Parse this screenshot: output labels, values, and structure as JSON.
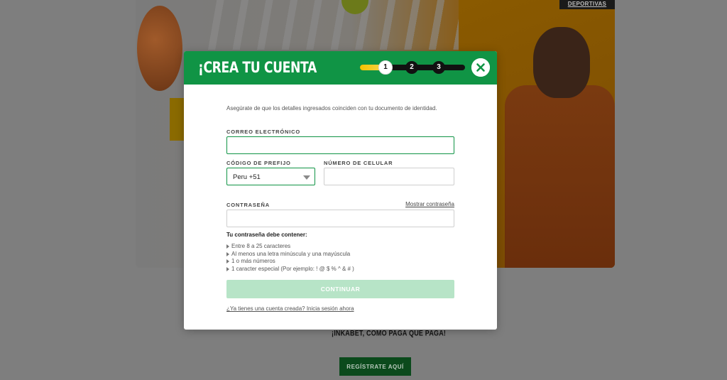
{
  "background": {
    "top_tab": "DEPORTIVAS",
    "slogan": "¡INKABET, CÓMO PAGA QUE PAGA!",
    "register_button": "REGÍSTRATE AQUÍ"
  },
  "modal": {
    "title": "¡CREA TU CUENTA",
    "steps": [
      "1",
      "2",
      "3"
    ],
    "current_step": 1,
    "progress": 0.22,
    "intro": "Asegúrate de que los detalles ingresados coinciden con tu documento de identidad.",
    "email": {
      "label": "CORREO ELECTRÓNICO",
      "value": ""
    },
    "prefix": {
      "label": "CÓDIGO DE PREFIJO",
      "value": "Peru +51"
    },
    "phone": {
      "label": "NÚMERO DE CELULAR",
      "value": ""
    },
    "password": {
      "label": "CONTRASEÑA",
      "value": "",
      "show_label": "Mostrar contraseña"
    },
    "requirements_title": "Tu contraseña debe contener:",
    "requirements": [
      "Entre 8 a 25 caracteres",
      "Al menos una letra minúscula y una mayúscula",
      "1 o más números",
      "1 caracter especial (Por ejemplo: ! @ $ % ^ & # )"
    ],
    "continue_button": "CONTINUAR",
    "login_link": "¿Ya tienes una cuenta creada? Inicia sesión ahora"
  },
  "colors": {
    "brand_green": "#109445",
    "continue_disabled": "#b7e4c7",
    "step_progress": "#f5c400"
  }
}
